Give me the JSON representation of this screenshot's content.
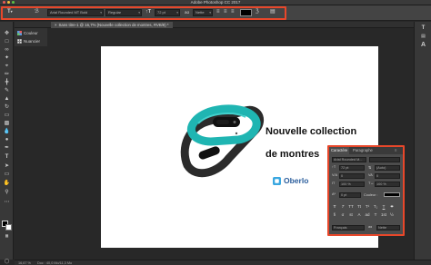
{
  "app": {
    "title": "Adobe Photoshop CC 2017"
  },
  "colors": {
    "highlight": "#e8472a",
    "panel": "#4c4c4c",
    "toolbar": "#383838",
    "workspace": "#282828",
    "band_teal": "#1fb5b2",
    "band_dark": "#2b2b2b",
    "brand_blue": "#2a5d9c"
  },
  "options_bar": {
    "tool_icon": "type-tool-icon",
    "orientation_icon": "text-orientation-icon",
    "font_family": "Arial Rounded MT Bold",
    "font_style": "Regular",
    "size_icon": "font-size-icon",
    "font_size": "72 pt",
    "aa_label": "aɑ",
    "antialias": "Nette",
    "align_icons": [
      "align-left-icon",
      "align-center-icon",
      "align-right-icon"
    ],
    "color_label": "",
    "warp_icon": "warp-text-icon",
    "panel_toggle_icon": "character-panel-icon"
  },
  "document": {
    "tab_label": "Sans titre-1 @ 16,7% (Nouvelle collection  de montres, RVB/8) *",
    "headline_line1": "Nouvelle collection",
    "headline_line2": "de montres",
    "brand": "Oberlo",
    "brand_icon": "oberlo-logo-icon"
  },
  "panels_collapsed": [
    {
      "label": "Couleur",
      "icon": "color-wheel-icon"
    },
    {
      "label": "Nuancier",
      "icon": "swatches-icon"
    }
  ],
  "tools": [
    "move-icon",
    "marquee-icon",
    "lasso-icon",
    "quick-select-icon",
    "crop-icon",
    "eyedropper-icon",
    "healing-icon",
    "brush-icon",
    "stamp-icon",
    "history-brush-icon",
    "eraser-icon",
    "gradient-icon",
    "blur-icon",
    "dodge-icon",
    "pen-icon",
    "type-icon",
    "path-select-icon",
    "shape-icon",
    "hand-icon",
    "zoom-icon",
    "more-icon"
  ],
  "right_strip": [
    "type-tool-icon",
    "paragraph-icon",
    "character-icon"
  ],
  "character_panel": {
    "tab_character": "Caractère",
    "tab_paragraph": "Paragraphe",
    "font_family": "Arial Rounded M...",
    "font_style": "",
    "font_size": "72 pt",
    "leading": "(Auto)",
    "kerning": "0",
    "tracking": "0",
    "vertical_scale": "100 %",
    "horizontal_scale": "100 %",
    "baseline": "0 pt",
    "color_label": "Couleur :",
    "style_buttons": [
      "T",
      "T",
      "TT",
      "Tt",
      "T¹",
      "T₁",
      "T",
      "T"
    ],
    "opentype_buttons": [
      "fi",
      "σ",
      "st",
      "A",
      "ad",
      "T",
      "1st",
      "½"
    ],
    "language": "Français",
    "antialias_label": "aɑ",
    "antialias": "Nette"
  },
  "status": {
    "zoom": "16,67 %",
    "doc_info": "Doc : 40,0 Mo/11,3 Mo"
  }
}
